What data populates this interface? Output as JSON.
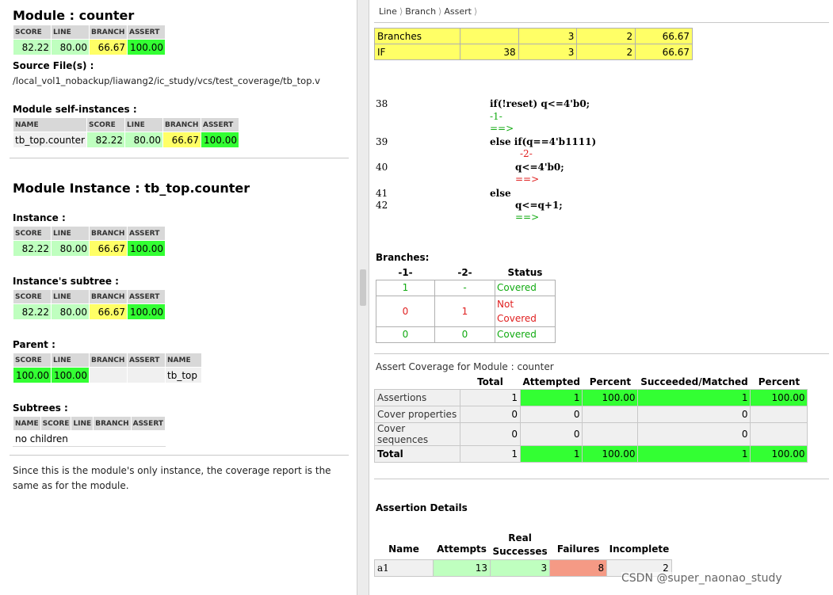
{
  "left": {
    "module_title": "Module : counter",
    "module_table": {
      "headers": [
        "SCORE",
        "LINE",
        "BRANCH",
        "ASSERT"
      ],
      "values": [
        "82.22",
        "80.00",
        "66.67",
        "100.00"
      ]
    },
    "source_files_label": "Source File(s) :",
    "source_path": "/local_vol1_nobackup/liawang2/ic_study/vcs/test_coverage/tb_top.v",
    "self_instances_label": "Module self-instances :",
    "self_instances_table": {
      "headers": [
        "NAME",
        "SCORE",
        "LINE",
        "BRANCH",
        "ASSERT"
      ],
      "values": [
        "tb_top.counter",
        "82.22",
        "80.00",
        "66.67",
        "100.00"
      ]
    },
    "instance_title": "Module Instance : tb_top.counter",
    "instance_label": "Instance :",
    "instance_table": {
      "headers": [
        "SCORE",
        "LINE",
        "BRANCH",
        "ASSERT"
      ],
      "values": [
        "82.22",
        "80.00",
        "66.67",
        "100.00"
      ]
    },
    "subtree_label": "Instance's subtree :",
    "subtree_table": {
      "headers": [
        "SCORE",
        "LINE",
        "BRANCH",
        "ASSERT"
      ],
      "values": [
        "82.22",
        "80.00",
        "66.67",
        "100.00"
      ]
    },
    "parent_label": "Parent :",
    "parent_table": {
      "headers": [
        "SCORE",
        "LINE",
        "BRANCH",
        "ASSERT",
        "NAME"
      ],
      "values": [
        "100.00",
        "100.00",
        "",
        "",
        "tb_top"
      ]
    },
    "subtrees_label": "Subtrees :",
    "subtrees_table": {
      "headers": [
        "NAME",
        "SCORE",
        "LINE",
        "BRANCH",
        "ASSERT"
      ],
      "empty": "no children"
    },
    "note": "Since this is the module's only instance, the coverage report is the same as for the module."
  },
  "right": {
    "breadcrumb": [
      "Line",
      "Branch",
      "Assert"
    ],
    "branch_rows": [
      [
        "Branches",
        "",
        "3",
        "2",
        "66.67"
      ],
      [
        "IF",
        "38",
        "3",
        "2",
        "66.67"
      ]
    ],
    "code": {
      "lines": [
        {
          "num": "38",
          "text": "if(!reset) q<=4'b0;"
        },
        {
          "num": "39",
          "text": "else if(q==4'b1111)"
        },
        {
          "num": "40",
          "text": "q<=4'b0;"
        },
        {
          "num": "41",
          "text": "else"
        },
        {
          "num": "42",
          "text": "q<=q+1;"
        }
      ],
      "marker1": "-1-",
      "marker2": "-2-",
      "arrow": "==>"
    },
    "branches_label": "Branches:",
    "status_table": {
      "headers": [
        "-1-",
        "-2-",
        "Status"
      ],
      "rows": [
        {
          "c1": "1",
          "c2": "-",
          "status": "Covered"
        },
        {
          "c1": "0",
          "c2": "1",
          "status_a": "Not",
          "status_b": "Covered"
        },
        {
          "c1": "0",
          "c2": "0",
          "status": "Covered"
        }
      ]
    },
    "assert_title": "Assert Coverage for Module : counter",
    "assert_table": {
      "headers": [
        "",
        "Total",
        "Attempted",
        "Percent",
        "Succeeded/Matched",
        "Percent"
      ],
      "rows": [
        [
          "Assertions",
          "1",
          "1",
          "100.00",
          "1",
          "100.00"
        ],
        [
          "Cover properties",
          "0",
          "0",
          "",
          "0",
          ""
        ],
        [
          "Cover sequences",
          "0",
          "0",
          "",
          "0",
          ""
        ],
        [
          "Total",
          "1",
          "1",
          "100.00",
          "1",
          "100.00"
        ]
      ]
    },
    "details_title": "Assertion Details",
    "details_table": {
      "headers": [
        "Name",
        "Attempts",
        "Real",
        "Successes",
        "Failures",
        "Incomplete"
      ],
      "row": [
        "a1",
        "13",
        "3",
        "8",
        "2"
      ]
    },
    "watermark": "CSDN @super_naonao_study"
  },
  "colors": {
    "light_green": "#bfffbf",
    "yellow": "#ffff66",
    "green": "#33ff33",
    "salmon": "#f59a85",
    "covered_green": "#11aa11",
    "not_covered_red": "#e02020"
  }
}
